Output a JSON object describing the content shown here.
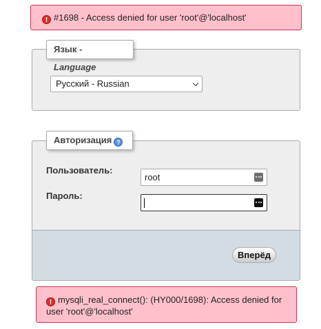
{
  "errors": {
    "top": "#1698 - Access denied for user 'root'@'localhost'",
    "bottom": "mysqli_real_connect(): (HY000/1698): Access denied for user 'root'@'localhost'"
  },
  "language": {
    "legend_main": "Язык - ",
    "legend_italic": "Language",
    "selected": "Русский - Russian"
  },
  "login": {
    "legend": "Авторизация",
    "username_label": "Пользователь:",
    "username_value": "root",
    "password_label": "Пароль:",
    "submit_label": "Вперёд"
  },
  "icons": {
    "error": "error-icon",
    "help": "help-icon",
    "password_manager": "key-icon"
  }
}
